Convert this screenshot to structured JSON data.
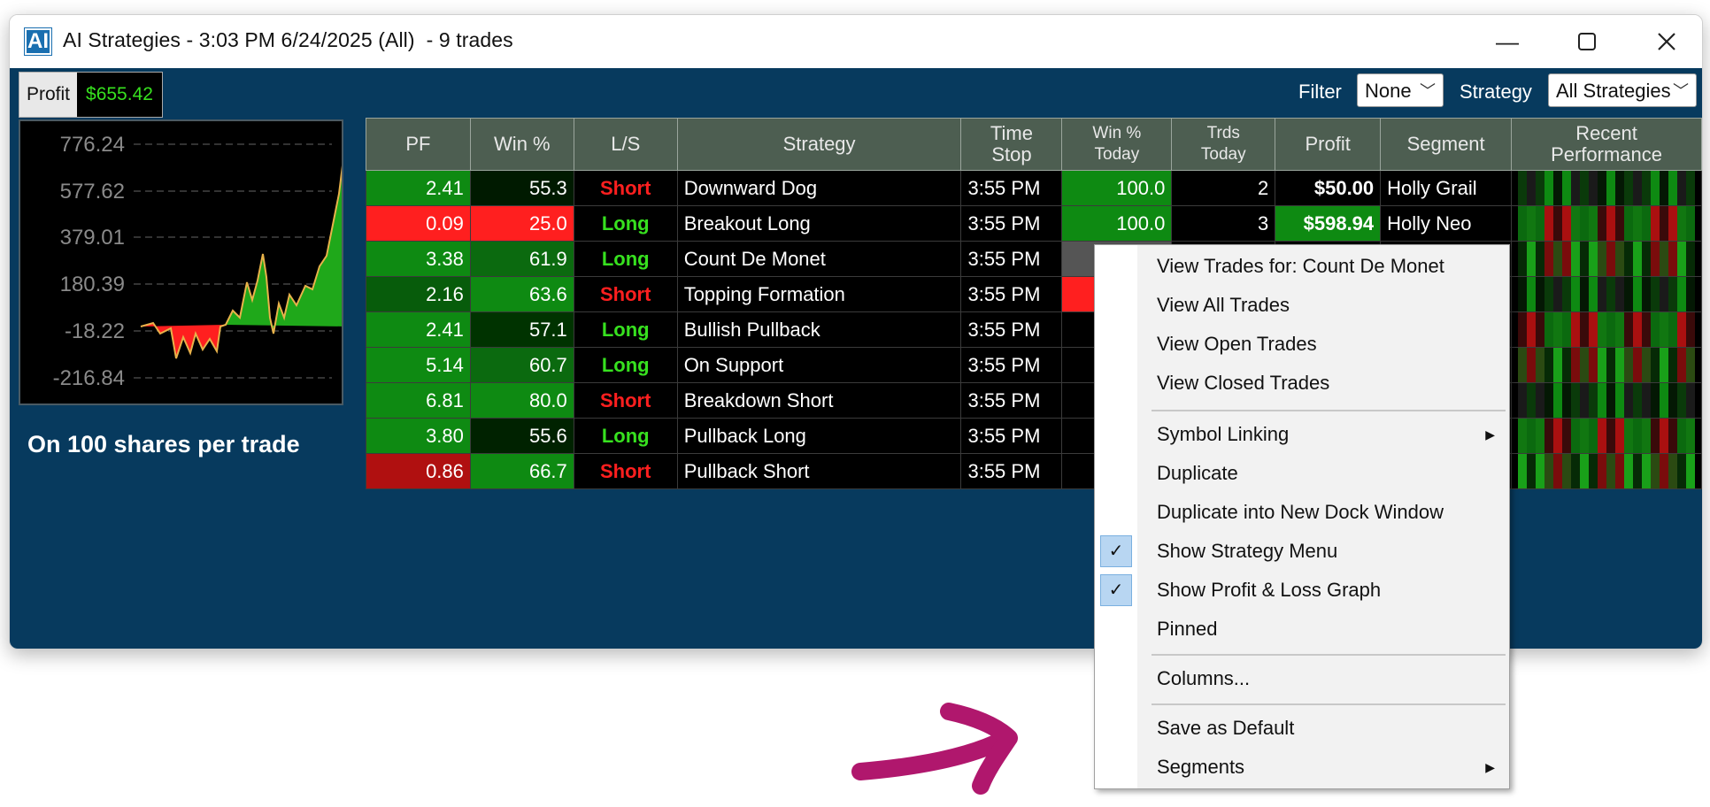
{
  "window": {
    "title": "AI Strategies - 3:03 PM 6/24/2025 (All)  - 9 trades",
    "icon_text": "AI",
    "minimize_icon": "minimize-icon",
    "maximize_icon": "maximize-icon",
    "close_icon": "close-icon"
  },
  "summary": {
    "profit_label": "Profit",
    "profit_value": "$655.42"
  },
  "graph": {
    "y_ticks": [
      "776.24",
      "577.62",
      "379.01",
      "180.39",
      "-18.22",
      "-216.84"
    ],
    "caption": "On 100 shares per trade"
  },
  "filters": {
    "filter_label": "Filter",
    "filter_value": "None",
    "strategy_label": "Strategy",
    "strategy_value": "All Strategies"
  },
  "table": {
    "headers": {
      "pf": "PF",
      "win": "Win %",
      "ls": "L/S",
      "strategy": "Strategy",
      "time_stop_1": "Time",
      "time_stop_2": "Stop",
      "win_today_1": "Win %",
      "win_today_2": "Today",
      "trds_today_1": "Trds",
      "trds_today_2": "Today",
      "profit": "Profit",
      "segment": "Segment",
      "recent_1": "Recent",
      "recent_2": "Performance"
    },
    "rows": [
      {
        "pf": "2.41",
        "win": "55.3",
        "ls": "Short",
        "strategy": "Downward Dog",
        "time": "3:55 PM",
        "win_today": "100.0",
        "trds_today": "2",
        "profit": "$50.00",
        "segment": "Holly Grail"
      },
      {
        "pf": "0.09",
        "win": "25.0",
        "ls": "Long",
        "strategy": "Breakout Long",
        "time": "3:55 PM",
        "win_today": "100.0",
        "trds_today": "3",
        "profit": "$598.94",
        "segment": "Holly Neo"
      },
      {
        "pf": "3.38",
        "win": "61.9",
        "ls": "Long",
        "strategy": "Count De Monet",
        "time": "3:55 PM",
        "win_today": "",
        "trds_today": "",
        "profit": "",
        "segment": ""
      },
      {
        "pf": "2.16",
        "win": "63.6",
        "ls": "Short",
        "strategy": "Topping Formation",
        "time": "3:55 PM",
        "win_today": "",
        "trds_today": "",
        "profit": "",
        "segment": ""
      },
      {
        "pf": "2.41",
        "win": "57.1",
        "ls": "Long",
        "strategy": "Bullish Pullback",
        "time": "3:55 PM",
        "win_today": "",
        "trds_today": "",
        "profit": "",
        "segment": ""
      },
      {
        "pf": "5.14",
        "win": "60.7",
        "ls": "Long",
        "strategy": "On Support",
        "time": "3:55 PM",
        "win_today": "",
        "trds_today": "",
        "profit": "",
        "segment": ""
      },
      {
        "pf": "6.81",
        "win": "80.0",
        "ls": "Short",
        "strategy": "Breakdown Short",
        "time": "3:55 PM",
        "win_today": "",
        "trds_today": "",
        "profit": "",
        "segment": ""
      },
      {
        "pf": "3.80",
        "win": "55.6",
        "ls": "Long",
        "strategy": "Pullback Long",
        "time": "3:55 PM",
        "win_today": "",
        "trds_today": "",
        "profit": "",
        "segment": ""
      },
      {
        "pf": "0.86",
        "win": "66.7",
        "ls": "Short",
        "strategy": "Pullback Short",
        "time": "3:55 PM",
        "win_today": "",
        "trds_today": "",
        "profit": "",
        "segment": ""
      }
    ]
  },
  "context_menu": {
    "items": {
      "view_trades_for": "View Trades for: Count De Monet",
      "view_all": "View All Trades",
      "view_open": "View Open Trades",
      "view_closed": "View Closed Trades",
      "symbol_linking": "Symbol Linking",
      "duplicate": "Duplicate",
      "duplicate_dock": "Duplicate into New Dock Window",
      "show_strategy_menu": "Show Strategy Menu",
      "show_pl_graph": "Show Profit & Loss Graph",
      "pinned": "Pinned",
      "columns": "Columns...",
      "save_default": "Save as Default",
      "segments": "Segments"
    },
    "checked": {
      "show_strategy_menu": true,
      "show_pl_graph": true
    }
  },
  "colors": {
    "background": "#073a5e",
    "header": "#4d5e51",
    "long": "#37e11f",
    "short": "#ff1f1f",
    "annotation_arrow": "#b0176d"
  }
}
